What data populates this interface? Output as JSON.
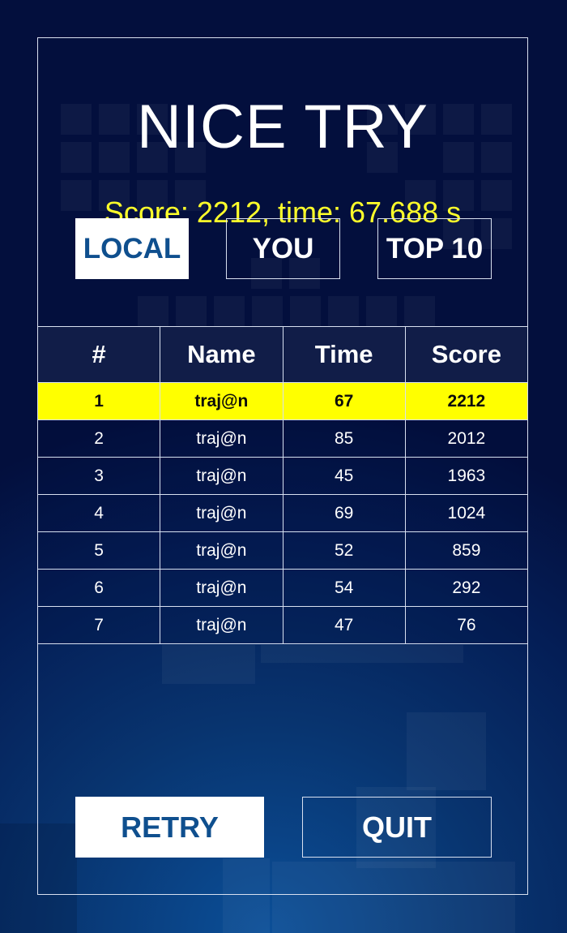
{
  "header": {
    "title": "NICE TRY",
    "score_line": "Score: 2212, time: 67.688 s"
  },
  "tabs": [
    {
      "label": "LOCAL",
      "active": true
    },
    {
      "label": "YOU",
      "active": false
    },
    {
      "label": "TOP 10",
      "active": false
    }
  ],
  "leaderboard": {
    "columns": [
      "#",
      "Name",
      "Time",
      "Score"
    ],
    "rows": [
      {
        "rank": "1",
        "name": "traj@n",
        "time": "67",
        "score": "2212",
        "highlight": true
      },
      {
        "rank": "2",
        "name": "traj@n",
        "time": "85",
        "score": "2012"
      },
      {
        "rank": "3",
        "name": "traj@n",
        "time": "45",
        "score": "1963"
      },
      {
        "rank": "4",
        "name": "traj@n",
        "time": "69",
        "score": "1024"
      },
      {
        "rank": "5",
        "name": "traj@n",
        "time": "52",
        "score": "859"
      },
      {
        "rank": "6",
        "name": "traj@n",
        "time": "54",
        "score": "292"
      },
      {
        "rank": "7",
        "name": "traj@n",
        "time": "47",
        "score": "76"
      }
    ]
  },
  "actions": {
    "retry_label": "RETRY",
    "quit_label": "QUIT"
  },
  "colors": {
    "highlight": "#ffff00",
    "score_text": "#ffff2a",
    "accent_text": "#0f4f8e",
    "background": "#041d55"
  }
}
